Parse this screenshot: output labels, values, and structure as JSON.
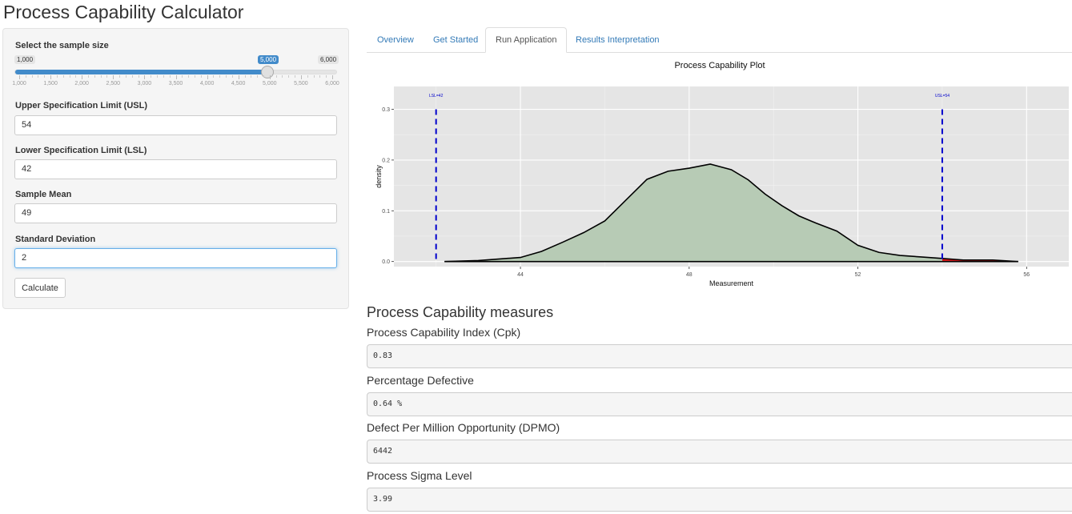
{
  "app": {
    "title": "Process Capability Calculator"
  },
  "sidebar": {
    "sample_size": {
      "label": "Select the sample size",
      "min_label": "1,000",
      "max_label": "6,000",
      "value_label": "5,000",
      "value": 5000,
      "min": 1000,
      "max": 6000,
      "tick_labels": [
        "1,000",
        "1,500",
        "2,000",
        "2,500",
        "3,000",
        "3,500",
        "4,000",
        "4,500",
        "5,000",
        "5,500",
        "6,000"
      ]
    },
    "usl": {
      "label": "Upper Specification Limit (USL)",
      "value": "54"
    },
    "lsl": {
      "label": "Lower Specification Limit (LSL)",
      "value": "42"
    },
    "mean": {
      "label": "Sample Mean",
      "value": "49"
    },
    "sd": {
      "label": "Standard Deviation",
      "value": "2"
    },
    "calculate_label": "Calculate"
  },
  "tabs": [
    {
      "label": "Overview",
      "active": false
    },
    {
      "label": "Get Started",
      "active": false
    },
    {
      "label": "Run Application",
      "active": true
    },
    {
      "label": "Results Interpretation",
      "active": false
    }
  ],
  "chart_data": {
    "type": "area",
    "title": "Process Capability Plot",
    "xlabel": "Measurement",
    "ylabel": "density",
    "xlim": [
      41.0,
      57.0
    ],
    "ylim": [
      -0.01,
      0.345
    ],
    "xticks": [
      44,
      48,
      52,
      56
    ],
    "yticks": [
      0.0,
      0.1,
      0.2,
      0.3
    ],
    "ytick_labels": [
      "0.0",
      "0.1",
      "0.2",
      "0.3"
    ],
    "grid": true,
    "colors": {
      "panel": "#e5e5e5",
      "fill": "#b7cbb5",
      "defect": "#e31a1c",
      "spec_line": "#0000cc",
      "curve": "#000000"
    },
    "density": {
      "x": [
        42.2,
        43.0,
        44.0,
        44.5,
        45.0,
        45.5,
        46.0,
        46.5,
        47.0,
        47.5,
        48.0,
        48.5,
        49.0,
        49.4,
        49.8,
        50.2,
        50.6,
        51.0,
        51.5,
        52.0,
        52.5,
        53.0,
        53.5,
        54.0,
        54.5,
        55.0,
        55.2,
        55.8
      ],
      "y": [
        0.0,
        0.002,
        0.008,
        0.02,
        0.038,
        0.057,
        0.08,
        0.121,
        0.162,
        0.178,
        0.184,
        0.192,
        0.181,
        0.161,
        0.133,
        0.11,
        0.09,
        0.076,
        0.06,
        0.032,
        0.018,
        0.012,
        0.009,
        0.006,
        0.003,
        0.003,
        0.003,
        0.0
      ]
    },
    "spec_limits": [
      {
        "name": "LSL",
        "x": 42,
        "label": "LSL=42"
      },
      {
        "name": "USL",
        "x": 54,
        "label": "USL=54"
      }
    ]
  },
  "measures": {
    "heading": "Process Capability measures",
    "items": [
      {
        "label": "Process Capability Index (Cpk)",
        "value": "0.83"
      },
      {
        "label": "Percentage Defective",
        "value": "0.64 %"
      },
      {
        "label": "Defect Per Million Opportunity (DPMO)",
        "value": "6442"
      },
      {
        "label": "Process Sigma Level",
        "value": "3.99"
      }
    ]
  }
}
